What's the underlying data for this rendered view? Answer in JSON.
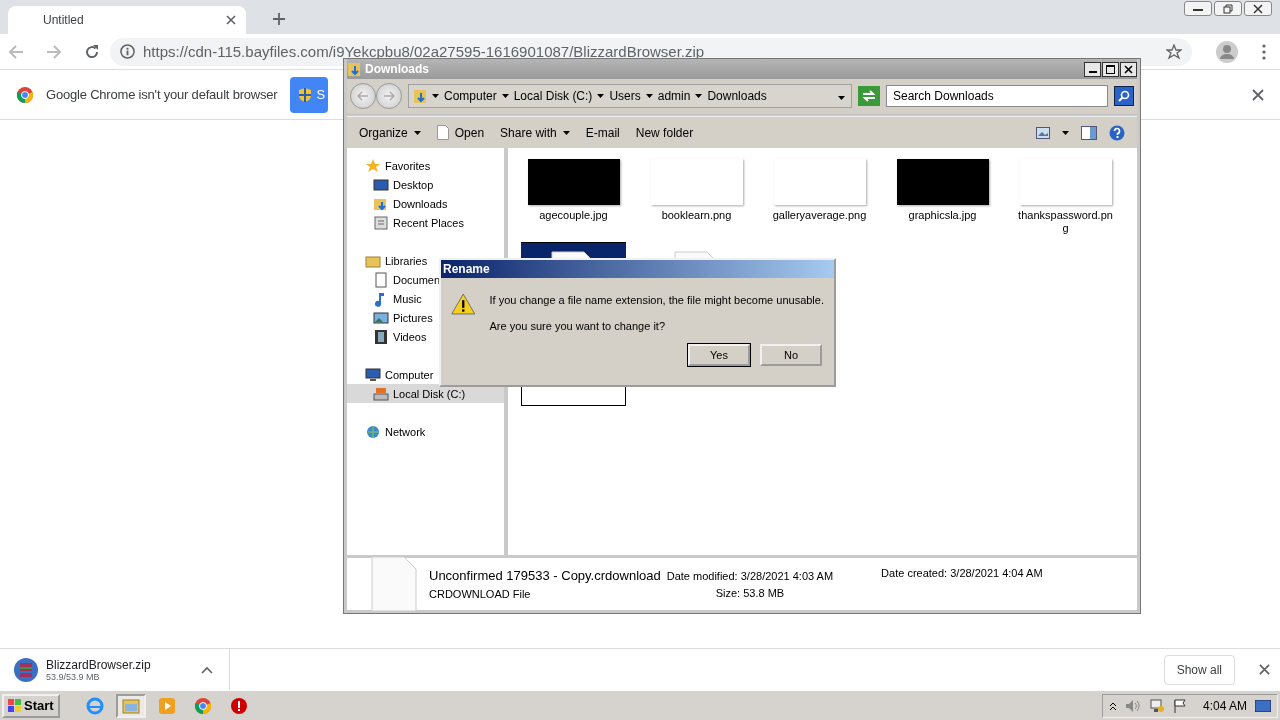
{
  "browser": {
    "tab": {
      "title": "Untitled"
    },
    "url": "https://cdn-115.bayfiles.com/i9Yekcpbu8/02a27595-1616901087/BlizzardBrowser.zip",
    "infobar": {
      "message": "Google Chrome isn't your default browser",
      "button": "S"
    }
  },
  "explorer": {
    "title": "Downloads",
    "breadcrumb": [
      "Computer",
      "Local Disk (C:)",
      "Users",
      "admin",
      "Downloads"
    ],
    "search": {
      "placeholder": "Search Downloads"
    },
    "commands": [
      {
        "label": "Organize",
        "kind": "menu"
      },
      {
        "label": "Open",
        "kind": "icon"
      },
      {
        "label": "Share with",
        "kind": "menu"
      },
      {
        "label": "E-mail",
        "kind": "plain"
      },
      {
        "label": "New folder",
        "kind": "plain"
      }
    ],
    "nav": [
      {
        "label": "Favorites",
        "kind": "star",
        "selected": false,
        "children": [
          {
            "label": "Desktop",
            "kind": "desktop",
            "selected": false
          },
          {
            "label": "Downloads",
            "kind": "download",
            "selected": false
          },
          {
            "label": "Recent Places",
            "kind": "recent",
            "selected": false
          }
        ]
      },
      {
        "label": "Libraries",
        "kind": "library",
        "selected": false,
        "children": [
          {
            "label": "Documen",
            "kind": "document",
            "selected": false
          },
          {
            "label": "Music",
            "kind": "music",
            "selected": false
          },
          {
            "label": "Pictures",
            "kind": "pictures",
            "selected": false
          },
          {
            "label": "Videos",
            "kind": "videos",
            "selected": false
          }
        ]
      },
      {
        "label": "Computer",
        "kind": "computer",
        "selected": false,
        "children": [
          {
            "label": "Local Disk (C:)",
            "kind": "disk",
            "selected": true
          }
        ]
      },
      {
        "label": "Network",
        "kind": "network",
        "selected": false
      }
    ],
    "files": [
      {
        "name": "agecouple.jpg",
        "kind": "dark",
        "selected": false
      },
      {
        "name": "booklearn.png",
        "kind": "light",
        "selected": false
      },
      {
        "name": "galleryaverage.png",
        "kind": "light",
        "selected": false
      },
      {
        "name": "graphicsla.jpg",
        "kind": "dark",
        "selected": false
      },
      {
        "name": "thankspassword.png",
        "kind": "light",
        "selected": false
      },
      {
        "kind": "document",
        "selected": true
      },
      {
        "kind": "document",
        "selected": false
      }
    ],
    "details": {
      "name": "Unconfirmed 179533 - Copy.crdownload",
      "type": "CRDOWNLOAD File",
      "modified_label": "Date modified:",
      "modified": "3/28/2021 4:03 AM",
      "created_label": "Date created:",
      "created": "3/28/2021 4:04 AM",
      "size_label": "Size:",
      "size": "53.8 MB"
    }
  },
  "dialog": {
    "title": "Rename",
    "lines": [
      "If you change a file name extension, the file might become unusable.",
      "Are you sure you want to change it?"
    ],
    "buttons": [
      {
        "label": "Yes",
        "selected": true
      },
      {
        "label": "No",
        "selected": false
      }
    ]
  },
  "downloads": {
    "file": "BlizzardBrowser.zip",
    "size": "53.9/53.9 MB",
    "show_all": "Show all"
  },
  "taskbar": {
    "start": "Start",
    "apps": [
      {
        "kind": "ie",
        "selected": false
      },
      {
        "kind": "folder",
        "selected": true
      },
      {
        "kind": "media",
        "selected": false
      },
      {
        "kind": "chrome",
        "selected": false
      },
      {
        "kind": "stop",
        "selected": false
      }
    ],
    "clock": "4:04 AM"
  }
}
